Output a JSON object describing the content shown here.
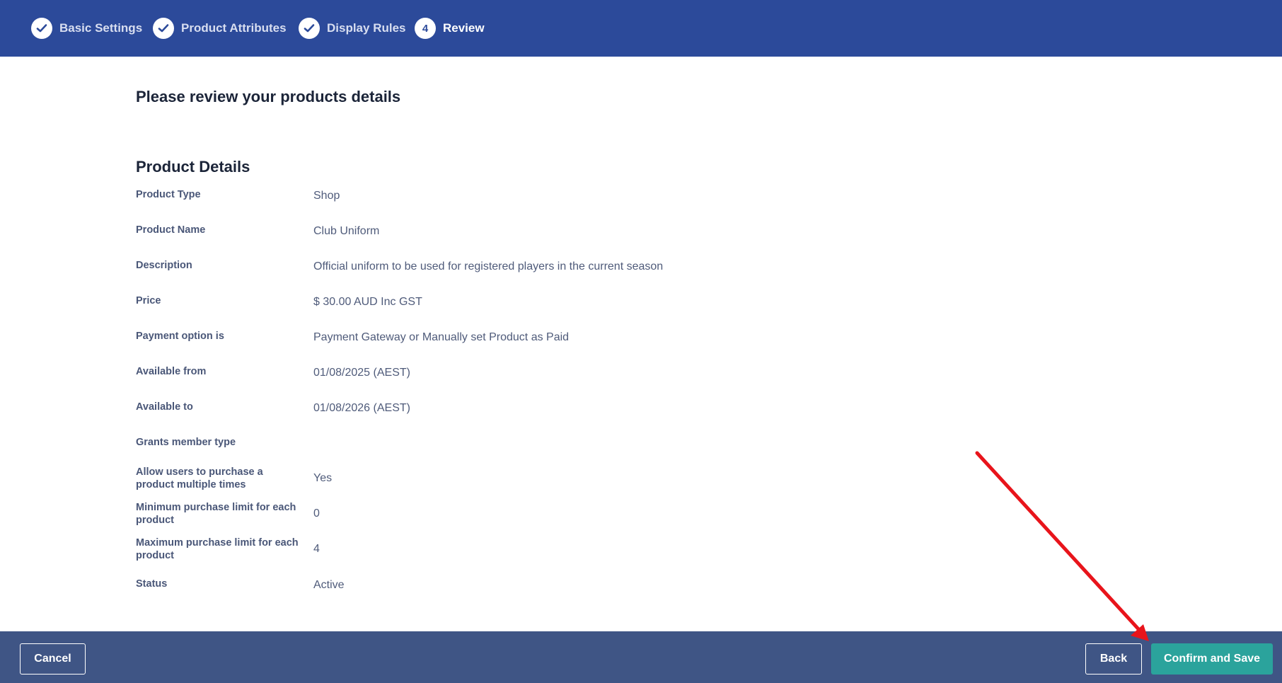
{
  "stepper": {
    "steps": [
      {
        "label": "Basic Settings",
        "state": "done"
      },
      {
        "label": "Product Attributes",
        "state": "done"
      },
      {
        "label": "Display Rules",
        "state": "done"
      },
      {
        "label": "Review",
        "number": "4",
        "state": "current"
      }
    ]
  },
  "page": {
    "title": "Please review your products details",
    "section_title": "Product Details"
  },
  "details": [
    {
      "label": "Product Type",
      "value": "Shop"
    },
    {
      "label": "Product Name",
      "value": "Club Uniform"
    },
    {
      "label": "Description",
      "value": "Official uniform to be used for registered players in the current season"
    },
    {
      "label": "Price",
      "value": "$ 30.00 AUD Inc GST"
    },
    {
      "label": "Payment option is",
      "value": "Payment Gateway or Manually set Product as Paid"
    },
    {
      "label": "Available from",
      "value": "01/08/2025 (AEST)"
    },
    {
      "label": "Available to",
      "value": "01/08/2026 (AEST)"
    },
    {
      "label": "Grants member type",
      "value": ""
    },
    {
      "label": "Allow users to purchase a product multiple times",
      "value": "Yes"
    },
    {
      "label": "Minimum purchase limit for each product",
      "value": "0"
    },
    {
      "label": "Maximum purchase limit for each product",
      "value": "4"
    },
    {
      "label": "Status",
      "value": "Active"
    }
  ],
  "footer": {
    "cancel_label": "Cancel",
    "back_label": "Back",
    "confirm_label": "Confirm and Save"
  },
  "colors": {
    "header_bg": "#2c4a9a",
    "footer_bg": "#3f5585",
    "primary_button": "#2ba39c",
    "annotation_arrow": "#e8141b"
  },
  "icons": {
    "step_done": "check-icon"
  }
}
